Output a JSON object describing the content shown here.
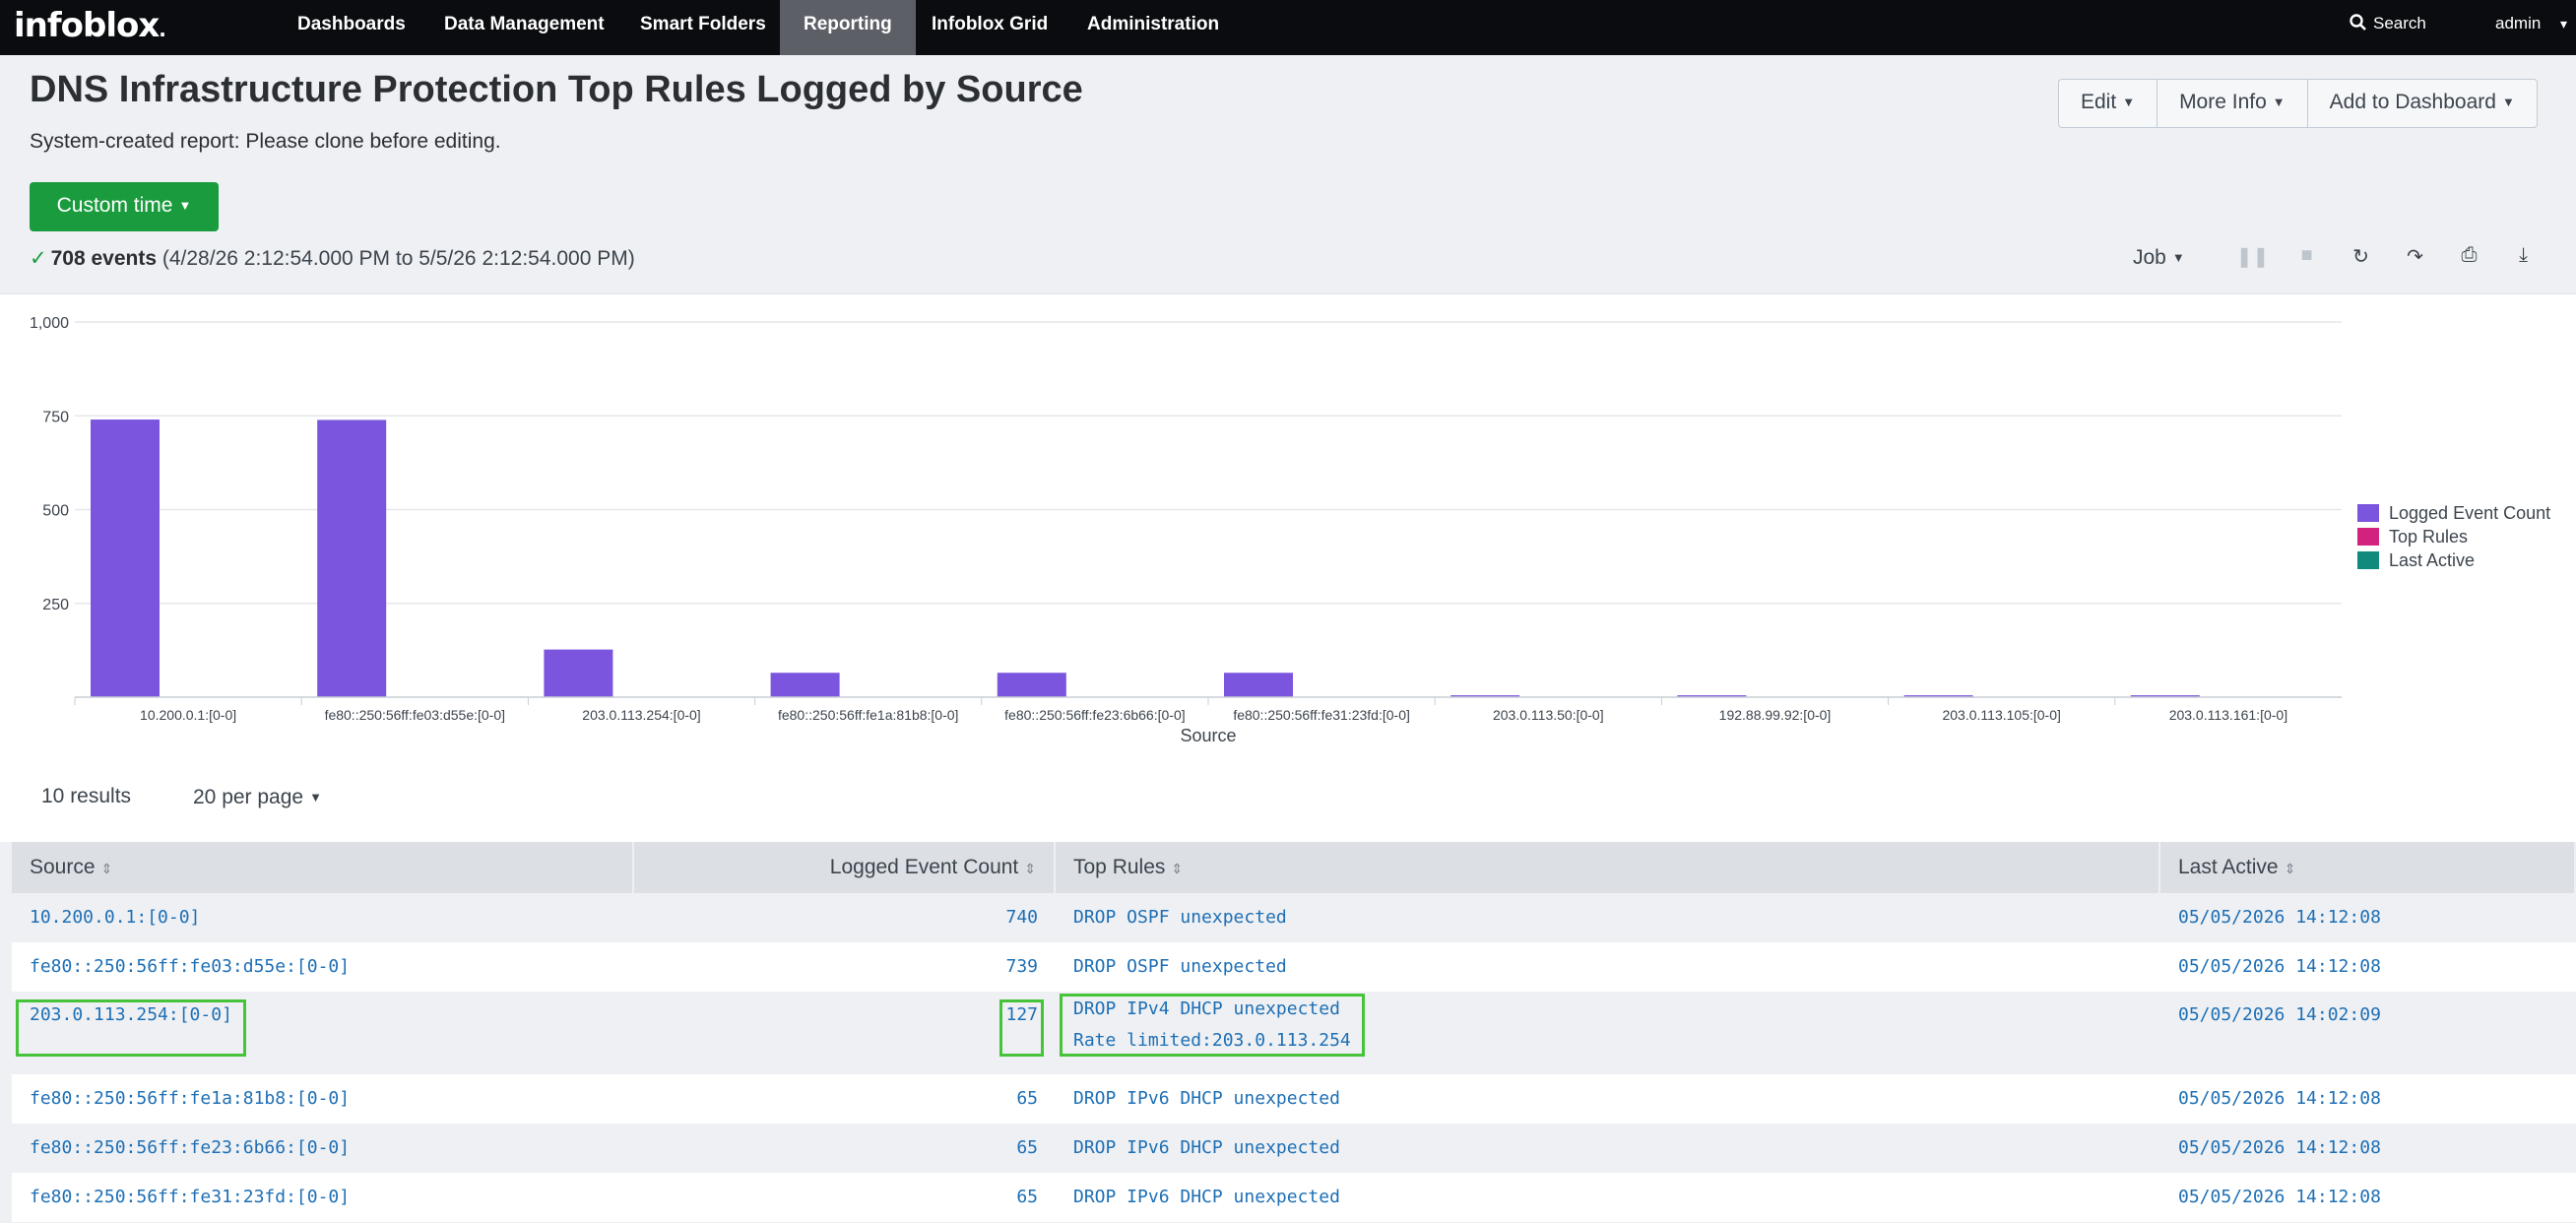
{
  "nav": {
    "logo": "infoblox",
    "items": [
      "Dashboards",
      "Data Management",
      "Smart Folders",
      "Reporting",
      "Infoblox Grid",
      "Administration"
    ],
    "active": "Reporting",
    "search_label": "Search",
    "user": "admin"
  },
  "header": {
    "title": "DNS Infrastructure Protection Top Rules Logged by Source",
    "subtitle": "System-created report: Please clone before editing.",
    "buttons": {
      "edit": "Edit",
      "more_info": "More Info",
      "add_to_dashboard": "Add to Dashboard"
    },
    "time_button": "Custom time",
    "events_count": "708 events",
    "events_range": "(4/28/26 2:12:54.000 PM to 5/5/26 2:12:54.000 PM)",
    "job_label": "Job"
  },
  "chart_data": {
    "type": "bar",
    "xlabel": "Source",
    "categories": [
      "10.200.0.1:[0-0]",
      "fe80::250:56ff:fe03:d55e:[0-0]",
      "203.0.113.254:[0-0]",
      "fe80::250:56ff:fe1a:81b8:[0-0]",
      "fe80::250:56ff:fe23:6b66:[0-0]",
      "fe80::250:56ff:fe31:23fd:[0-0]",
      "203.0.113.50:[0-0]",
      "192.88.99.92:[0-0]",
      "203.0.113.105:[0-0]",
      "203.0.113.161:[0-0]"
    ],
    "series": [
      {
        "name": "Logged Event Count",
        "color": "#7b55de",
        "values": [
          740,
          739,
          127,
          65,
          65,
          65,
          5,
          5,
          5,
          5
        ]
      }
    ],
    "yticks": [
      "1,000",
      "750",
      "500",
      "250"
    ],
    "ylim": [
      0,
      1000
    ],
    "legend": [
      {
        "name": "Logged Event Count",
        "color": "#7b55de"
      },
      {
        "name": "Top Rules",
        "color": "#d3217f"
      },
      {
        "name": "Last Active",
        "color": "#108a7c"
      }
    ],
    "legend_position": "right",
    "grid": true
  },
  "results": {
    "count_label": "10 results",
    "per_page": "20 per page",
    "columns": [
      "Source",
      "Logged Event Count",
      "Top Rules",
      "Last Active"
    ],
    "rows": [
      {
        "source": "10.200.0.1:[0-0]",
        "count": "740",
        "rules": [
          "DROP OSPF unexpected"
        ],
        "last_active": "05/05/2026 14:12:08"
      },
      {
        "source": "fe80::250:56ff:fe03:d55e:[0-0]",
        "count": "739",
        "rules": [
          "DROP OSPF unexpected"
        ],
        "last_active": "05/05/2026 14:12:08"
      },
      {
        "source": "203.0.113.254:[0-0]",
        "count": "127",
        "rules": [
          "DROP IPv4 DHCP unexpected",
          "Rate limited:203.0.113.254"
        ],
        "last_active": "05/05/2026 14:02:09"
      },
      {
        "source": "fe80::250:56ff:fe1a:81b8:[0-0]",
        "count": "65",
        "rules": [
          "DROP IPv6 DHCP unexpected"
        ],
        "last_active": "05/05/2026 14:12:08"
      },
      {
        "source": "fe80::250:56ff:fe23:6b66:[0-0]",
        "count": "65",
        "rules": [
          "DROP IPv6 DHCP unexpected"
        ],
        "last_active": "05/05/2026 14:12:08"
      },
      {
        "source": "fe80::250:56ff:fe31:23fd:[0-0]",
        "count": "65",
        "rules": [
          "DROP IPv6 DHCP unexpected"
        ],
        "last_active": "05/05/2026 14:12:08"
      }
    ]
  }
}
